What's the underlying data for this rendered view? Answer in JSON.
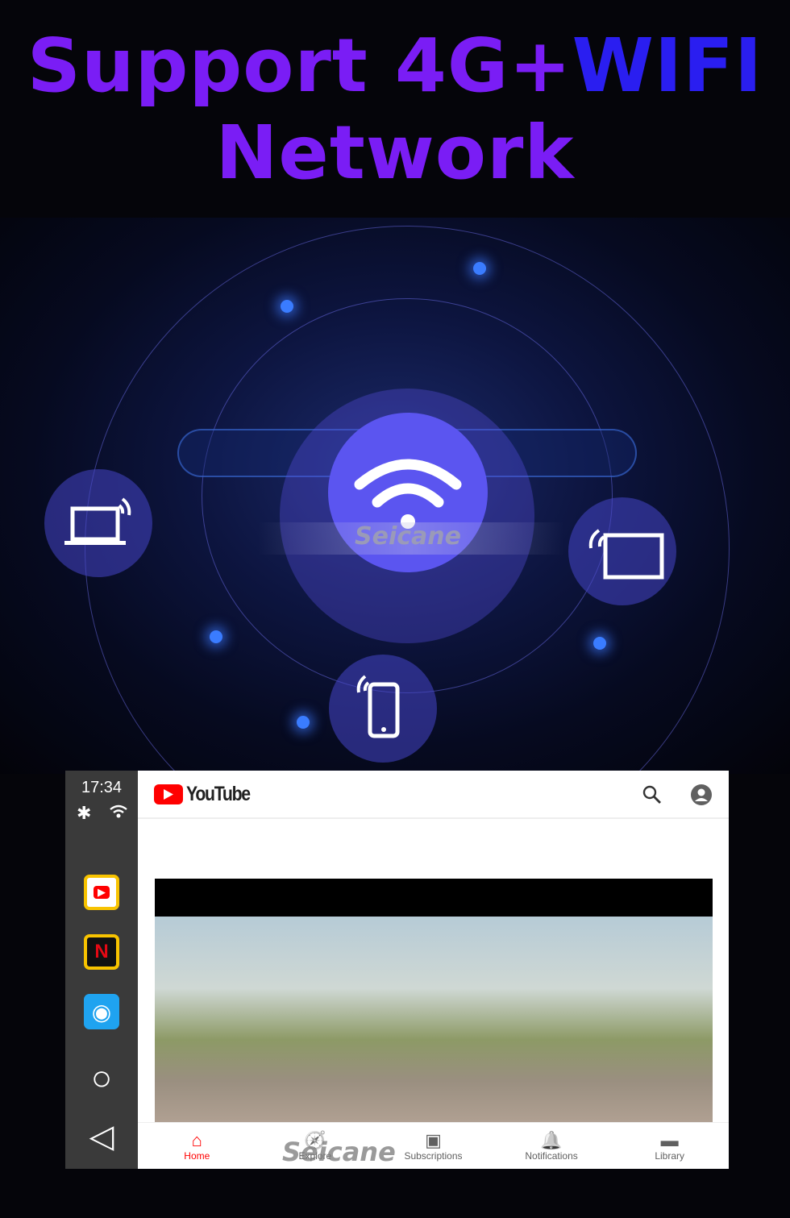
{
  "headline": {
    "line1_a": "Support 4G+",
    "line1_b": "WIFI",
    "line2": "Network"
  },
  "illustration": {
    "brand": "Seicane",
    "center_icon": "wifi-icon",
    "devices": [
      "laptop-icon",
      "tablet-icon",
      "phone-icon"
    ],
    "accent": "#5b55f0"
  },
  "status_rail": {
    "time": "17:34",
    "icons": [
      "bluetooth-icon",
      "wifi-icon"
    ],
    "apps": [
      {
        "name": "youtube-app-icon",
        "glyph": "▶"
      },
      {
        "name": "netflix-app-icon",
        "glyph": "N"
      },
      {
        "name": "chrome-app-icon",
        "glyph": "◉"
      }
    ],
    "home": "○",
    "back": "◁"
  },
  "youtube": {
    "logo": "YouTube",
    "search_icon": "search-icon",
    "account_icon": "account-icon",
    "nav": [
      {
        "label": "Home",
        "icon": "⌂"
      },
      {
        "label": "Explore",
        "icon": "🧭"
      },
      {
        "label": "Subscriptions",
        "icon": "▣"
      },
      {
        "label": "Notifications",
        "icon": "🔔"
      },
      {
        "label": "Library",
        "icon": "▬"
      }
    ],
    "brand_color": "#ff0000"
  },
  "watermark": "Seicane"
}
